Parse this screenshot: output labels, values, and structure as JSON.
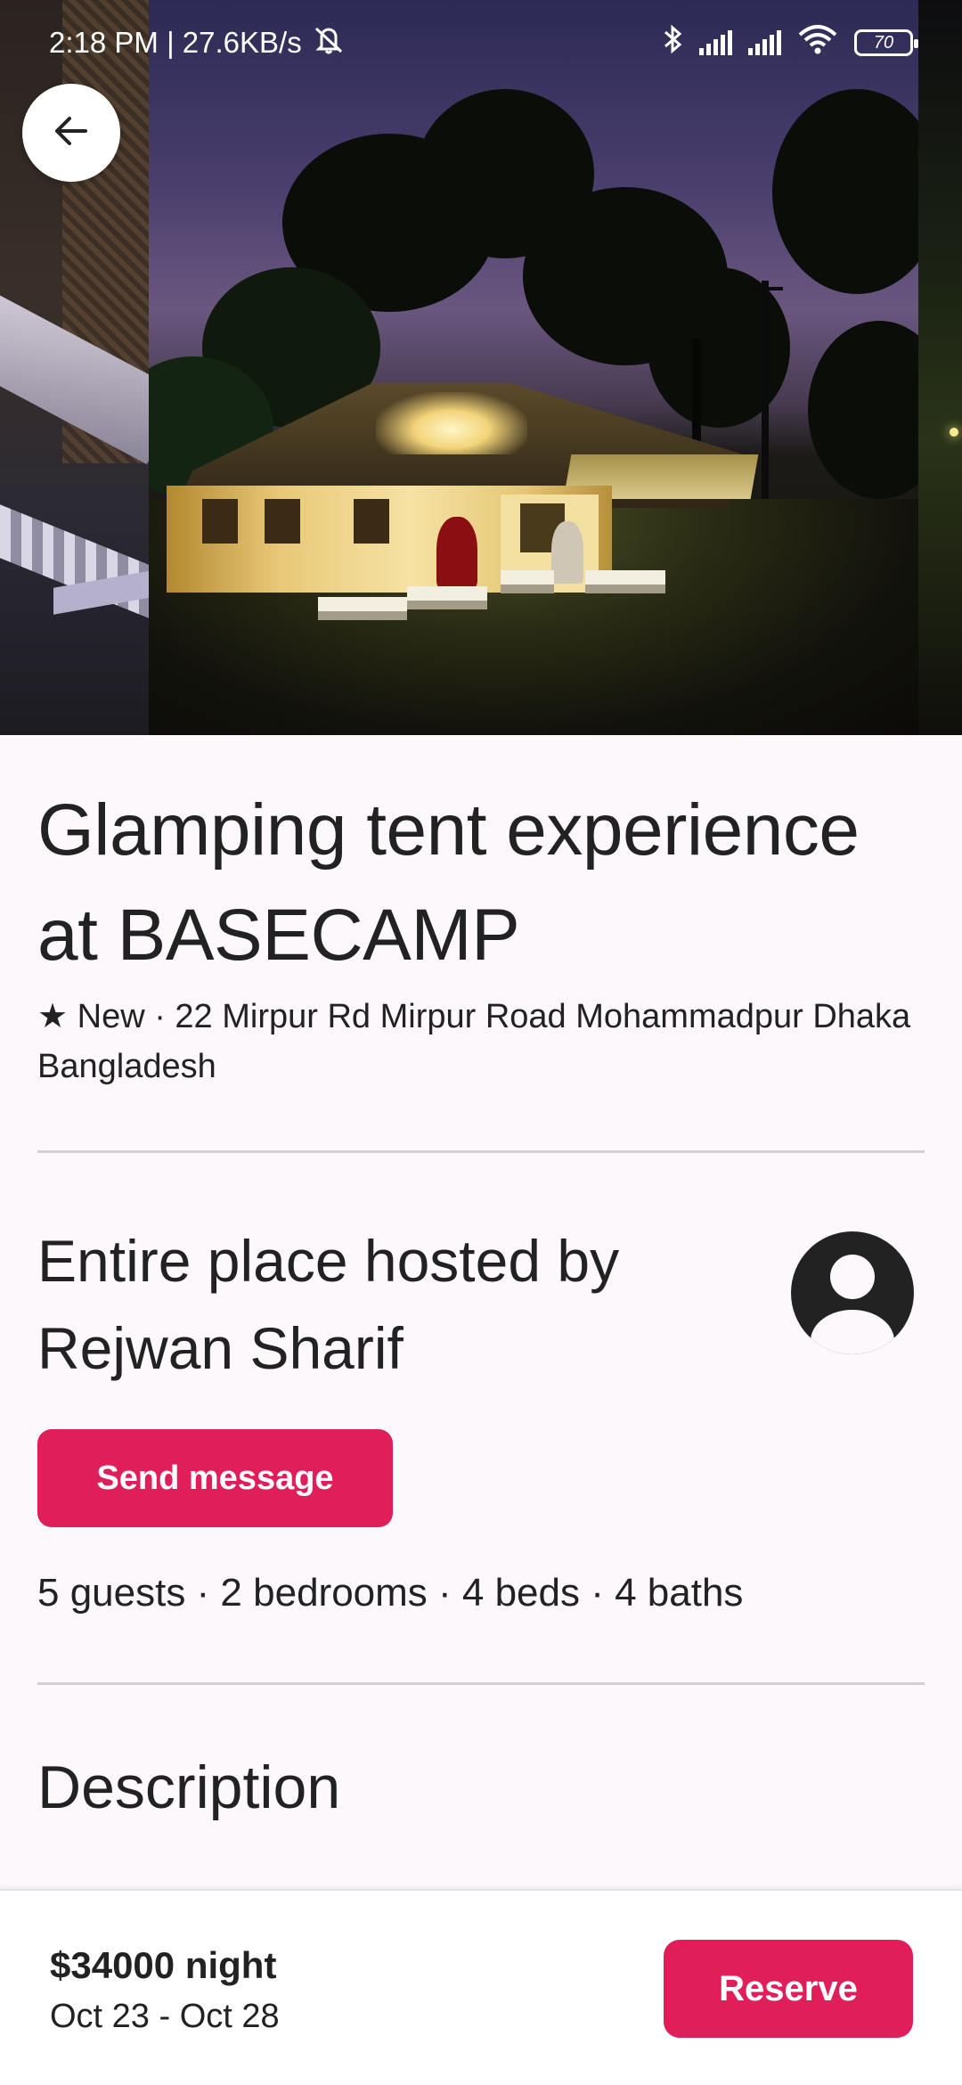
{
  "status_bar": {
    "time_speed": "2:18 PM | 27.6KB/s",
    "battery": "70"
  },
  "gallery": {
    "images": [
      {
        "name": "previous-photo"
      },
      {
        "name": "glamping-tent-night"
      },
      {
        "name": "next-photo"
      }
    ]
  },
  "listing": {
    "title": "Glamping tent experience at BASECAMP",
    "subtitle": "★ New · 22 Mirpur Rd Mirpur Road Mohammadpur Dhaka Bangladesh",
    "host_heading": "Entire place hosted by Rejwan Sharif",
    "send_message_label": "Send message",
    "details": "5 guests · 2 bedrooms · 4 beds · 4 baths",
    "description_heading": "Description"
  },
  "booking": {
    "price": "$34000 night",
    "dates": "Oct 23 - Oct 28",
    "reserve_label": "Reserve"
  },
  "colors": {
    "accent": "#e01e5a",
    "background": "#fcf8fc",
    "text": "#222222"
  },
  "icons": [
    "back-arrow-icon",
    "mute-icon",
    "bluetooth-icon",
    "signal-icon",
    "wifi-icon",
    "battery-icon",
    "user-avatar-icon"
  ]
}
